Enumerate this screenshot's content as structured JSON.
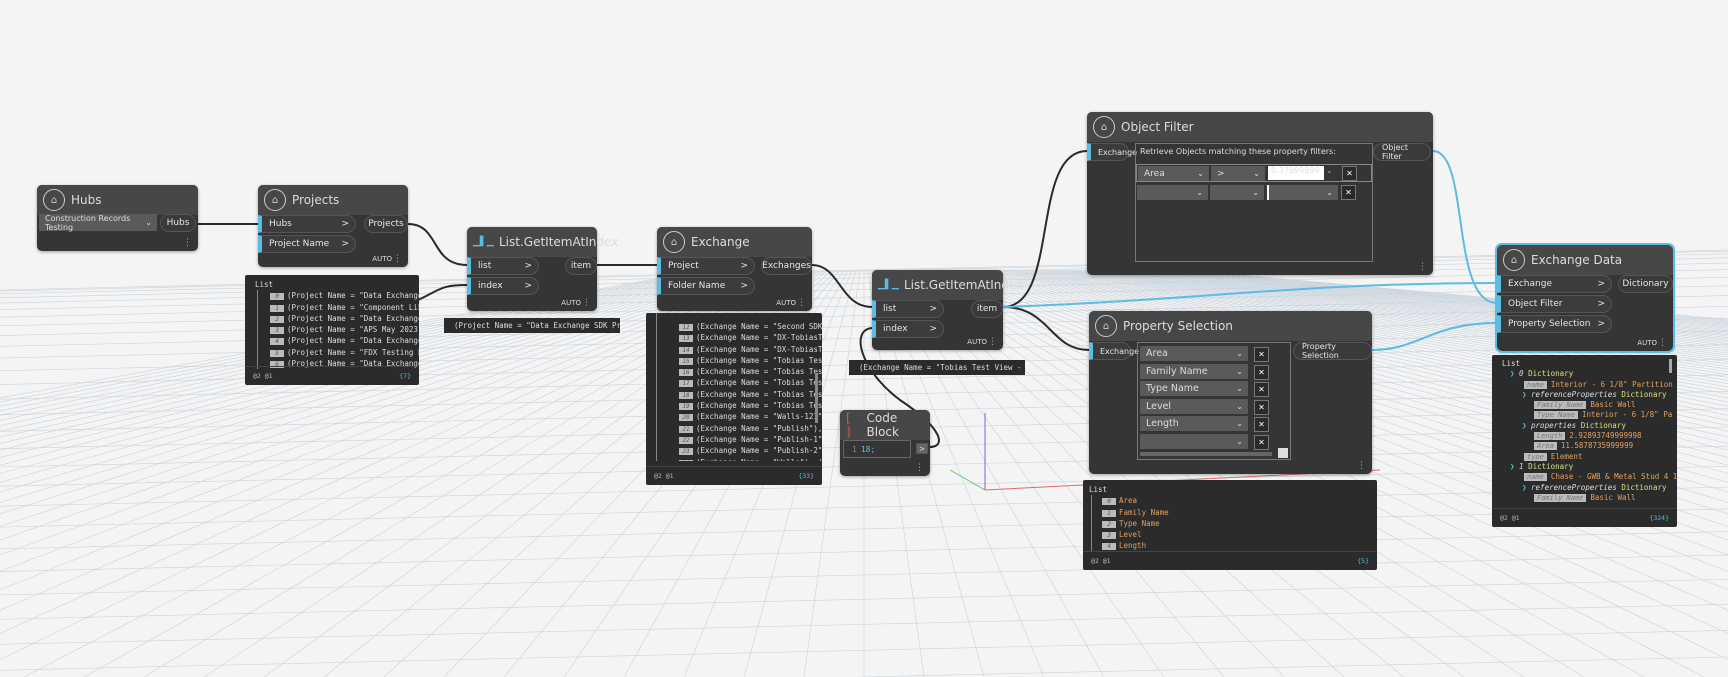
{
  "colors": {
    "accent": "#5bbce4",
    "node_bg": "#353535",
    "header_bg": "#474747",
    "canvas": "#f4f4f4"
  },
  "hubs": {
    "title": "Hubs",
    "icon": "dx-icon",
    "dropdown": "Construction Records Testing",
    "output": "Hubs"
  },
  "projects": {
    "title": "Projects",
    "inputs": [
      "Hubs",
      "Project Name"
    ],
    "output": "Projects",
    "auto": "AUTO",
    "preview": {
      "header": "List",
      "items": [
        "(Project Name = \"Data Exchanges",
        "(Project Name = \"Component Libr",
        "(Project Name = \"Data Exchange",
        "(Project Name = \"APS May 2023 A",
        "(Project Name = \"Data Exchange",
        "(Project Name = \"FDX Testing PR",
        "(Project Name = \"Data Exchange"
      ],
      "levels": "@2 @1",
      "count": "{7}"
    }
  },
  "getitem1": {
    "title": "List.GetItemAtIndex",
    "inputs": [
      "list",
      "index"
    ],
    "output": "item",
    "auto": "AUTO",
    "preview": "(Project Name = \"Data Exchange SDK Pri"
  },
  "exchange": {
    "title": "Exchange",
    "inputs": [
      "Project",
      "Folder Name"
    ],
    "output": "Exchanges",
    "auto": "AUTO",
    "preview": {
      "items": [
        [
          "12",
          "(Exchange Name = \"Second SDK E"
        ],
        [
          "13",
          "(Exchange Name = \"DX-TobiasTes"
        ],
        [
          "14",
          "(Exchange Name = \"DX-TobiasTes"
        ],
        [
          "15",
          "(Exchange Name = \"Tobias Test"
        ],
        [
          "16",
          "(Exchange Name = \"Tobias Test"
        ],
        [
          "17",
          "(Exchange Name = \"Tobias Test"
        ],
        [
          "18",
          "(Exchange Name = \"Tobias Test"
        ],
        [
          "19",
          "(Exchange Name = \"Tobias Test"
        ],
        [
          "20",
          "(Exchange Name = \"Walls-121\"),"
        ],
        [
          "21",
          "(Exchange Name = \"Publish\"), ("
        ],
        [
          "22",
          "(Exchange Name = \"Publish-1\"),"
        ],
        [
          "23",
          "(Exchange Name = \"Publish-2\"),"
        ],
        [
          "24",
          "(Exchange Name = \"Walls\"), (E"
        ]
      ],
      "levels": "@2 @1",
      "count": "{33}"
    }
  },
  "getitem2": {
    "title": "List.GetItemAtIndex",
    "inputs": [
      "list",
      "index"
    ],
    "output": "item",
    "auto": "AUTO",
    "preview": "(Exchange Name = \"Tobias Test View - W"
  },
  "codeblock": {
    "title": "Code Block",
    "line": "1",
    "code": "18;",
    "output": ">"
  },
  "objectfilter": {
    "title": "Object Filter",
    "input": "Exchange",
    "output": "Object Filter",
    "description": "Retrieve Objects matching these property filters:",
    "rows": [
      {
        "property": "Area",
        "operator": ">",
        "value": "0.37999989"
      },
      {
        "property": "",
        "operator": "",
        "value": ""
      }
    ]
  },
  "propsel": {
    "title": "Property Selection",
    "input": "Exchange",
    "output": "Property Selection",
    "items": [
      "Area",
      "Family Name",
      "Type Name",
      "Level",
      "Length",
      ""
    ],
    "preview": {
      "header": "List",
      "items": [
        "Area",
        "Family Name",
        "Type Name",
        "Level",
        "Length"
      ],
      "levels": "@2 @1",
      "count": "{5}"
    }
  },
  "exchangedata": {
    "title": "Exchange Data",
    "inputs": [
      "Exchange",
      "Object Filter",
      "Property Selection"
    ],
    "output": "Dictionary",
    "auto": "AUTO",
    "preview": {
      "header": "List",
      "d0": "0",
      "dict": "Dictionary",
      "name_key": "name",
      "name0": "Interior - 6 1/8\" Partition",
      "refprops": "referenceProperties",
      "fam_key": "Family Name",
      "fam_val": "Basic Wall",
      "type_key": "Type Name",
      "type_val": "Interior - 6 1/8\" Pa",
      "props": "properties",
      "len_key": "Length",
      "len_val": "2.92893749999998",
      "area_key": "Area",
      "area_val": "11.5878735999999",
      "typek": "type",
      "typev": "Element",
      "d1": "1",
      "name1": "Chase - GWB & Metal Stud 4 1",
      "levels": "@2 @1",
      "count": "{324}"
    }
  }
}
